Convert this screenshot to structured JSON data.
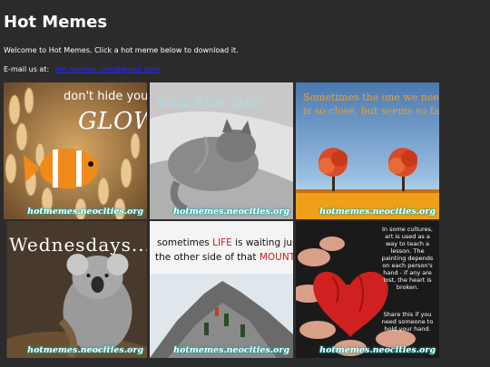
{
  "page": {
    "title": "Hot Memes",
    "welcome": "Welcome to Hot Memes. Click a hot meme below to download it.",
    "email_label": "E-mail us at:",
    "email_link": "hot.memes.com@gmail.com"
  },
  "memes": [
    {
      "line1": "don't hide your",
      "line2": "GLOW",
      "watermark": "hotmemes.neocities.org",
      "subject": "clownfish-in-anemone"
    },
    {
      "line1": "BAD FUR DAY",
      "watermark": "hotmemes.neocities.org",
      "subject": "sleeping-cat"
    },
    {
      "line1": "Sometimes the one we need",
      "line2": "is so close, but seems so far...",
      "watermark": "hotmemes.neocities.org",
      "subject": "two-trees-field"
    },
    {
      "line1": "Wednesdays...",
      "watermark": "hotmemes.neocities.org",
      "subject": "koala"
    },
    {
      "line1_pre": "sometimes ",
      "line1_red": "LIFE",
      "line1_post": " is waiting just on",
      "line2_pre": "the other side of that ",
      "line2_red": "MOUNTAIN",
      "watermark": "hotmemes.neocities.org",
      "subject": "climbers-on-mountain"
    },
    {
      "text1": "In some cultures, art is used as a way to teach a lesson. The painting depends on each person's hand - if any are lost, the heart is broken.",
      "text2": "Share this if you need someone to hold your hand.",
      "watermark": "hotmemes.neocities.org",
      "subject": "hands-holding-heart"
    }
  ],
  "colors": {
    "background": "#2b2b2b",
    "link": "#2a2aff",
    "caption_orange": "#f0a020",
    "caption_red": "#c81e1e"
  }
}
